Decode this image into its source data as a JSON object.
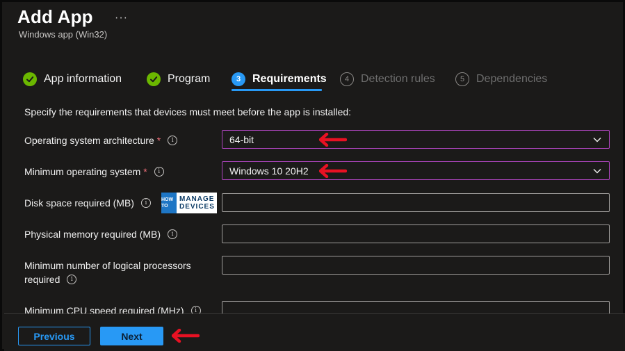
{
  "header": {
    "title": "Add App",
    "more_label": "···",
    "subtitle": "Windows app (Win32)"
  },
  "steps": [
    {
      "label": "App information",
      "state": "done",
      "number": "1"
    },
    {
      "label": "Program",
      "state": "done",
      "number": "2"
    },
    {
      "label": "Requirements",
      "state": "current",
      "number": "3"
    },
    {
      "label": "Detection rules",
      "state": "future",
      "number": "4"
    },
    {
      "label": "Dependencies",
      "state": "future",
      "number": "5"
    }
  ],
  "description": "Specify the requirements that devices must meet before the app is installed:",
  "fields": {
    "os_arch": {
      "label": "Operating system architecture",
      "required": "*",
      "value": "64-bit"
    },
    "min_os": {
      "label": "Minimum operating system",
      "required": "*",
      "value": "Windows 10 20H2"
    },
    "disk_space": {
      "label": "Disk space required (MB)",
      "value": ""
    },
    "physical_memory": {
      "label": "Physical memory required (MB)",
      "value": ""
    },
    "logical_processors": {
      "label_line1": "Minimum number of logical processors",
      "label_line2": "required",
      "value": ""
    },
    "cpu_speed": {
      "label": "Minimum CPU speed required (MHz)",
      "value": ""
    }
  },
  "logo": {
    "how_to": "HOW TO",
    "line1": "MANAGE",
    "line2": "DEVICES"
  },
  "footer": {
    "previous_label": "Previous",
    "next_label": "Next"
  },
  "colors": {
    "accent": "#2899f5",
    "success": "#6bb700",
    "annotation_arrow": "#e81123",
    "focus_border": "#b146c2"
  },
  "icons": {
    "info": "info-icon",
    "chevron": "chevron-down-icon",
    "check": "checkmark-icon",
    "arrow": "red-arrow-left-icon"
  }
}
